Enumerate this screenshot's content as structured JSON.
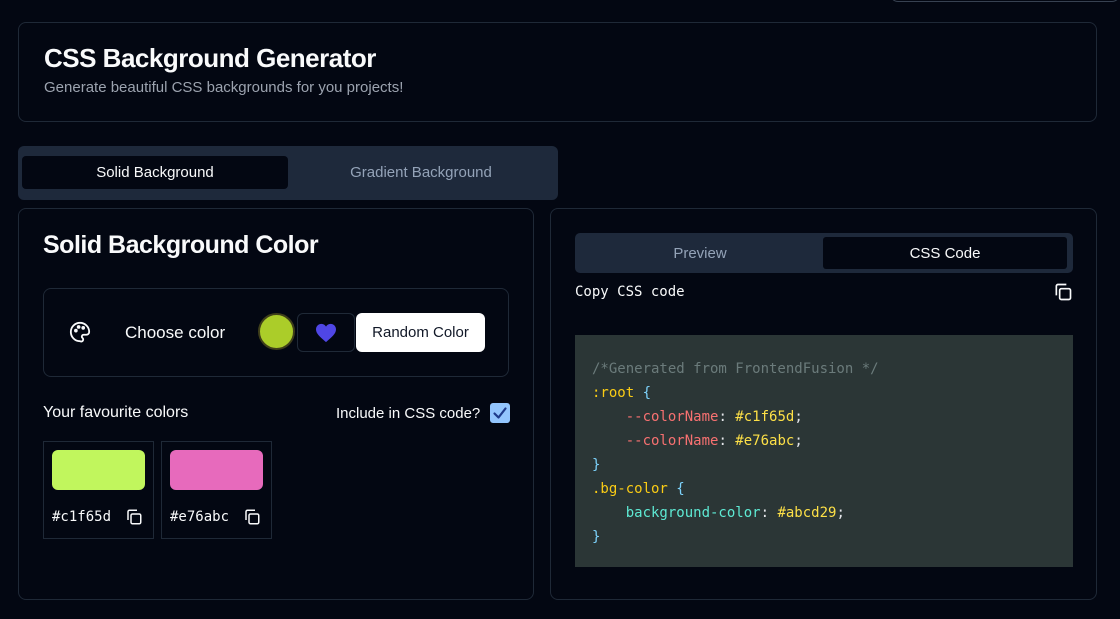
{
  "header": {
    "title": "CSS Background Generator",
    "subtitle": "Generate beautiful CSS backgrounds for you projects!"
  },
  "tabs": [
    {
      "label": "Solid Background",
      "active": true
    },
    {
      "label": "Gradient Background",
      "active": false
    }
  ],
  "solid": {
    "title": "Solid Background Color",
    "choose_label": "Choose color",
    "current_color": "#abcd29",
    "random_button": "Random Color",
    "favourites_label": "Your favourite colors",
    "include_label": "Include in CSS code?",
    "include_checked": true,
    "favourites": [
      {
        "hex": "#c1f65d",
        "color": "#c1f65d"
      },
      {
        "hex": "#e76abc",
        "color": "#e76abc"
      }
    ]
  },
  "output": {
    "tabs": [
      {
        "label": "Preview",
        "active": false
      },
      {
        "label": "CSS Code",
        "active": true
      }
    ],
    "copy_label": "Copy CSS code",
    "code": {
      "comment": "/*Generated from FrontendFusion */",
      "root_selector": ":root",
      "var1_name": "--colorName",
      "var1_value": "#c1f65d",
      "var2_name": "--colorName",
      "var2_value": "#e76abc",
      "class_selector": ".bg-color",
      "prop_name": "background-color",
      "prop_value": "#abcd29"
    }
  },
  "icons": {
    "palette": "palette-icon",
    "heart": "heart-icon",
    "copy": "copy-icon",
    "check": "check-icon"
  },
  "colors": {
    "background": "#030712",
    "accent_heart": "#4f46e5",
    "tab_bar": "#1e293b",
    "code_bg": "#2b3636"
  }
}
